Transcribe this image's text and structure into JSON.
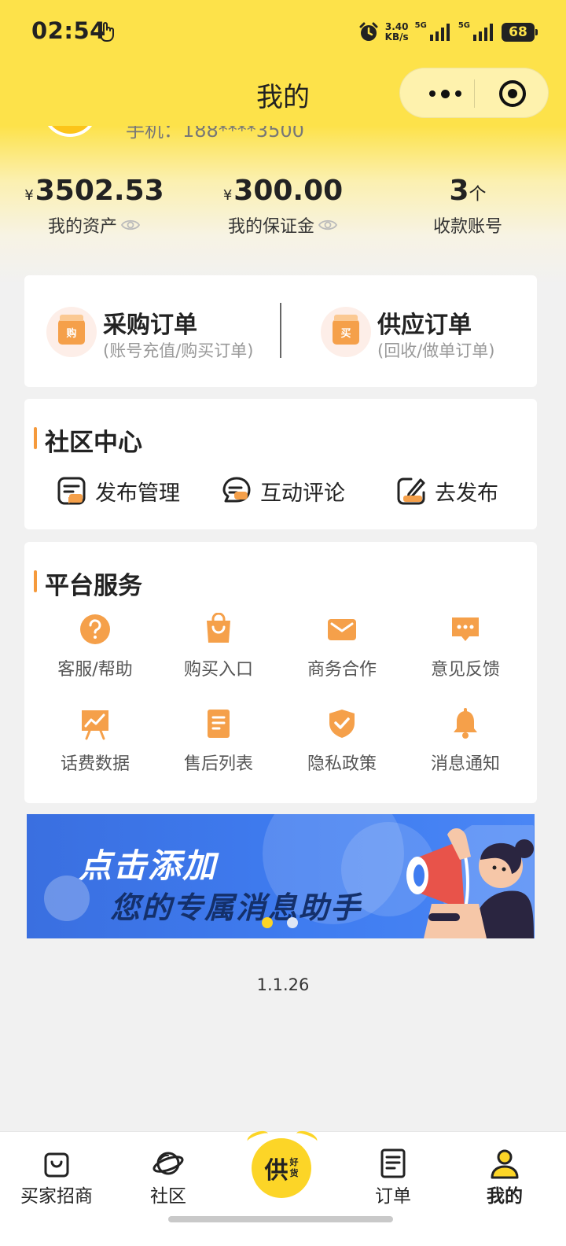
{
  "status_bar": {
    "time": "02:54",
    "speed_value": "3.40",
    "speed_unit": "KB/s",
    "signal1": "5G",
    "signal2": "5G",
    "battery": "68"
  },
  "nav": {
    "title": "我的"
  },
  "profile": {
    "phone_peek": "手机：188****3500"
  },
  "stats": [
    {
      "currency": "¥",
      "value": "3502.53",
      "unit": "",
      "label": "我的资产"
    },
    {
      "currency": "¥",
      "value": "300.00",
      "unit": "",
      "label": "我的保证金"
    },
    {
      "currency": "",
      "value": "3",
      "unit": "个",
      "label": "收款账号"
    }
  ],
  "orders": {
    "purchase": {
      "title": "采购订单",
      "subtitle": "(账号充值/购买订单)",
      "badge": "购"
    },
    "supply": {
      "title": "供应订单",
      "subtitle": "(回收/做单订单)",
      "badge": "买"
    }
  },
  "community": {
    "title": "社区中心",
    "items": [
      "发布管理",
      "互动评论",
      "去发布"
    ]
  },
  "services": {
    "title": "平台服务",
    "items": [
      "客服/帮助",
      "购买入口",
      "商务合作",
      "意见反馈",
      "话费数据",
      "售后列表",
      "隐私政策",
      "消息通知"
    ]
  },
  "banner": {
    "line1": "点击添加",
    "line2": "您的专属消息助手",
    "active_slide": 1,
    "slide_count": 2
  },
  "version": "1.1.26",
  "tabbar": {
    "items": [
      "买家招商",
      "社区",
      "订单",
      "我的"
    ],
    "center_main": "供",
    "center_side1": "好",
    "center_side2": "货",
    "active": "我的"
  },
  "colors": {
    "brand_yellow": "#fde24a",
    "accent_orange": "#f5a04a",
    "banner_blue": "#3f7cf0"
  }
}
